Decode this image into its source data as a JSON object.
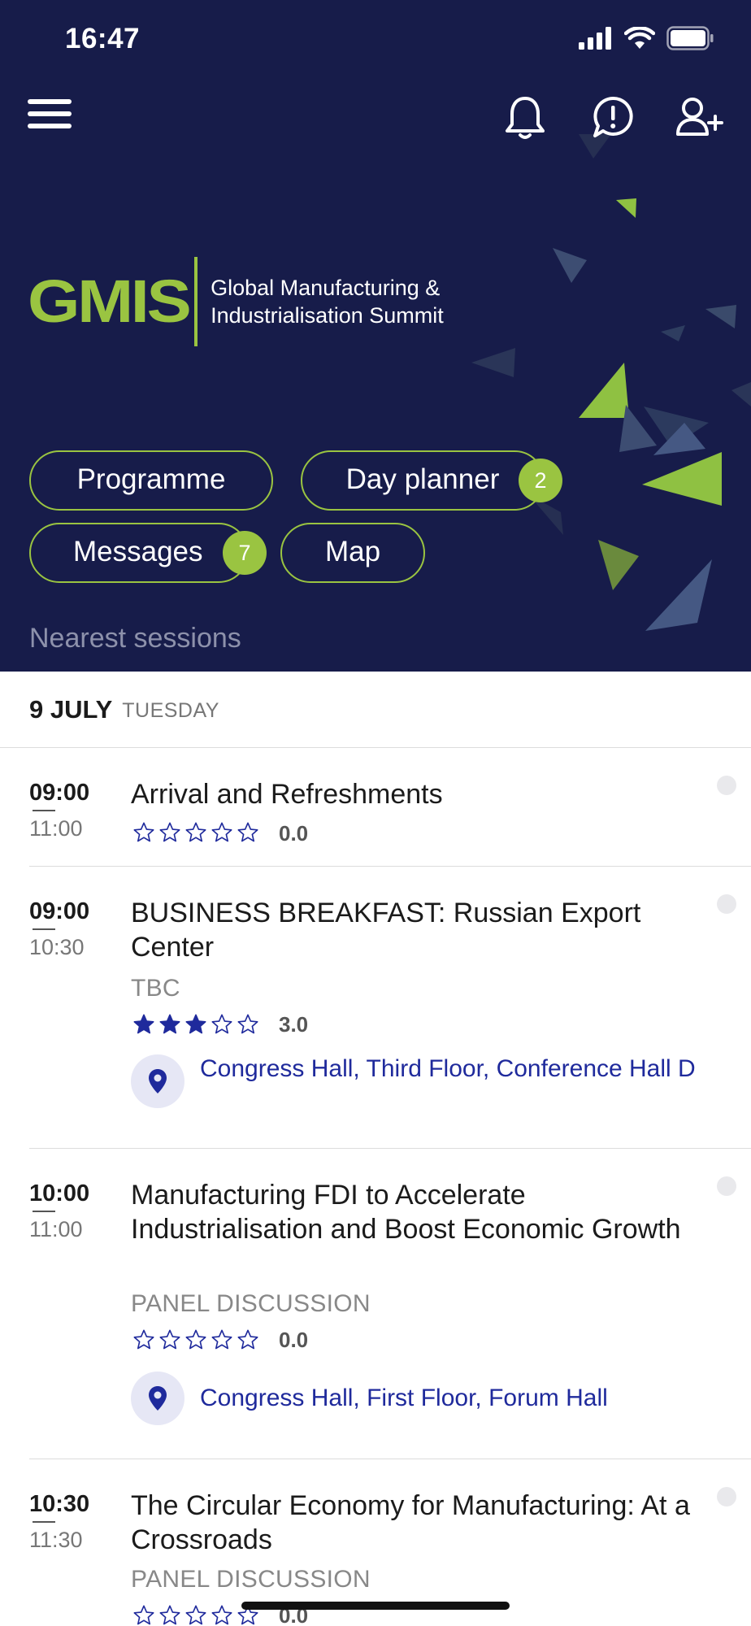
{
  "status_bar": {
    "time": "16:47"
  },
  "logo": {
    "mark": "GMIS",
    "line1": "Global Manufacturing &",
    "line2": "Industrialisation Summit"
  },
  "nav": {
    "programme": "Programme",
    "day_planner": "Day planner",
    "day_planner_badge": "2",
    "messages": "Messages",
    "messages_badge": "7",
    "map": "Map"
  },
  "section_title": "Nearest sessions",
  "date": {
    "main": "9 JULY",
    "day": "TUESDAY"
  },
  "sessions": [
    {
      "start": "09:00",
      "end": "11:00",
      "title": "Arrival and Refreshments",
      "subtitle": "",
      "rating": "0.0",
      "stars_filled": 0,
      "location": ""
    },
    {
      "start": "09:00",
      "end": "10:30",
      "title": "BUSINESS BREAKFAST: Russian Export Center",
      "subtitle": "TBC",
      "rating": "3.0",
      "stars_filled": 3,
      "location": "Congress Hall, Third Floor, Conference Hall D"
    },
    {
      "start": "10:00",
      "end": "11:00",
      "title": "Manufacturing FDI to Accelerate Industrialisation and Boost Economic Growth",
      "subtitle": "PANEL DISCUSSION",
      "rating": "0.0",
      "stars_filled": 0,
      "location": "Congress Hall, First Floor, Forum Hall"
    },
    {
      "start": "10:30",
      "end": "11:30",
      "title": "The Circular Economy for Manufacturing: At a Crossroads",
      "subtitle": "PANEL DISCUSSION",
      "rating": "0.0",
      "stars_filled": 0,
      "location": ""
    }
  ],
  "colors": {
    "header_bg": "#171c4a",
    "accent_green": "#9ac441",
    "link_blue": "#1f2a9c",
    "star_blue": "#1f2a9c"
  },
  "icons": [
    "menu-icon",
    "bell-icon",
    "info-icon",
    "add-user-icon",
    "location-pin-icon",
    "star-icon",
    "signal-icon",
    "wifi-icon",
    "battery-icon"
  ]
}
